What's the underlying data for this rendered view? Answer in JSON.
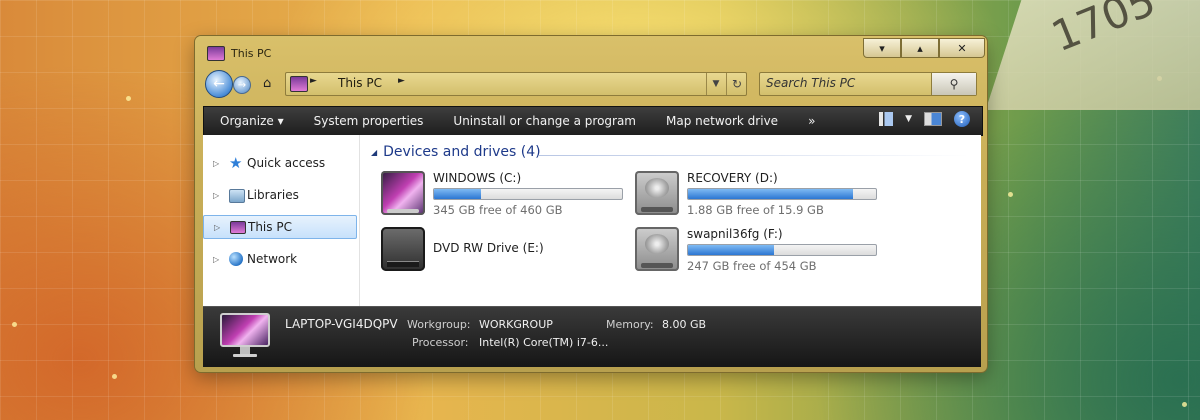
{
  "window": {
    "title": "This PC",
    "controls": {
      "minimize": "▾",
      "maximize": "▴",
      "close": "✕"
    }
  },
  "navbar": {
    "back_glyph": "←",
    "forward_glyph": "→",
    "home_glyph": "⌂",
    "address_separator": "►",
    "address_text": "This PC",
    "dropdown_glyph": "▼",
    "refresh_glyph": "↻",
    "search_placeholder": "Search This PC",
    "search_glyph": "⚲"
  },
  "command_bar": {
    "organize": "Organize ▾",
    "system_properties": "System properties",
    "uninstall": "Uninstall or change a program",
    "map_network_drive": "Map network drive",
    "more": "»",
    "view_caret": "▼",
    "help": "?"
  },
  "nav_pane": {
    "expand_glyph": "▷",
    "items": [
      {
        "label": "Quick access"
      },
      {
        "label": "Libraries"
      },
      {
        "label": "This PC"
      },
      {
        "label": "Network"
      }
    ]
  },
  "content": {
    "group_caret": "◢",
    "group_title": "Devices and drives (4)",
    "drives": [
      {
        "name": "WINDOWS (C:)",
        "free_text": "345 GB free of 460 GB",
        "used_fraction": 0.25
      },
      {
        "name": "RECOVERY (D:)",
        "free_text": "1.88 GB free of 15.9 GB",
        "used_fraction": 0.88
      },
      {
        "name": "DVD RW Drive (E:)"
      },
      {
        "name": "swapnil36fg (F:)",
        "free_text": "247 GB free of 454 GB",
        "used_fraction": 0.46
      }
    ]
  },
  "details": {
    "pc_name": "LAPTOP-VGI4DQPV",
    "workgroup_label": "Workgroup:",
    "workgroup_value": "WORKGROUP",
    "memory_label": "Memory:",
    "memory_value": "8.00 GB",
    "processor_label": "Processor:",
    "processor_value": "Intel(R) Core(TM) i7-6..."
  },
  "wallpaper": {
    "tag_text": "1705"
  },
  "colors": {
    "accent": "#2b76d2",
    "window_frame": "#c9ae57",
    "command_bar": "#2a2a2a",
    "group_title": "#1e3a8a"
  }
}
